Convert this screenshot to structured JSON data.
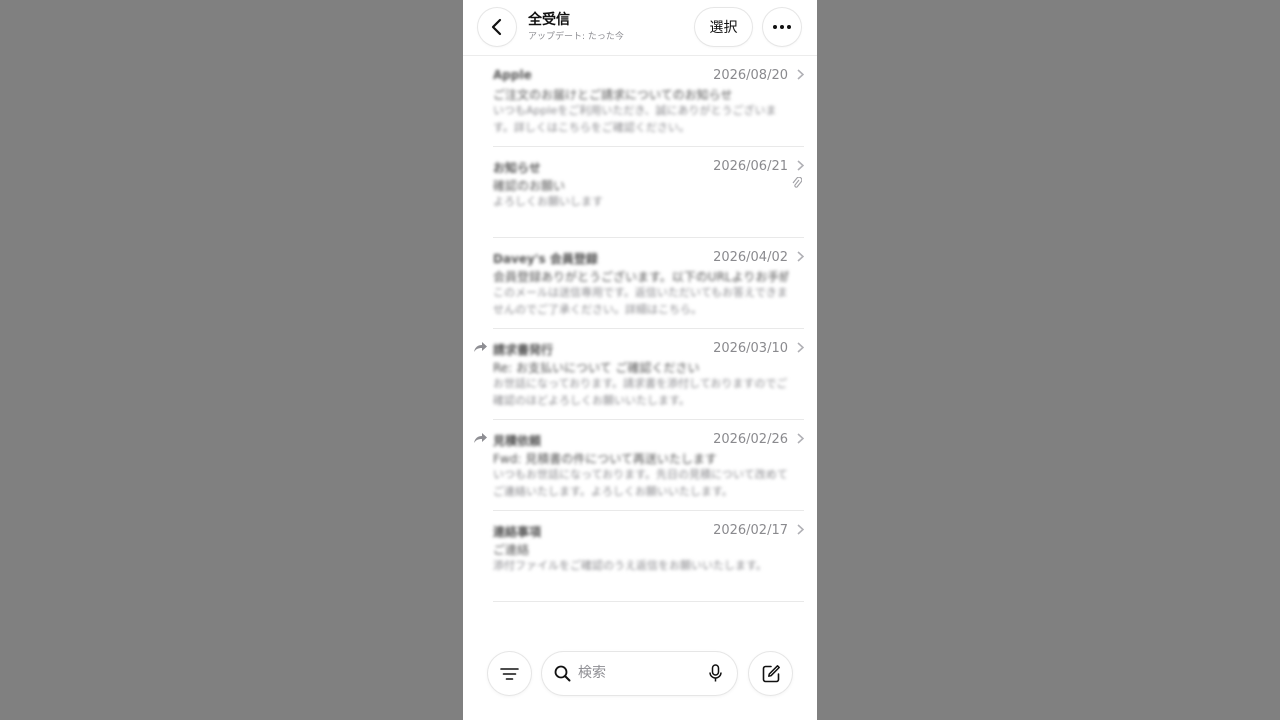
{
  "header": {
    "title": "全受信",
    "subtitle": "アップデート: たった今",
    "select_label": "選択"
  },
  "mails": [
    {
      "sender": "Apple",
      "date": "2026/08/20",
      "subject": "ご注文のお届けとご請求についてのお知らせ",
      "preview": "いつもAppleをご利用いただき、誠にありがとうございます。詳しくはこちらをご確認ください。",
      "forwarded": false,
      "attachment": false
    },
    {
      "sender": "お知らせ",
      "date": "2026/06/21",
      "subject": "確認のお願い",
      "preview": "よろしくお願いします",
      "forwarded": false,
      "attachment": true
    },
    {
      "sender": "Davey's 会員登録",
      "date": "2026/04/02",
      "subject": "会員登録ありがとうございます。以下のURLよりお手続きを完了してください。",
      "preview": "このメールは送信専用です。返信いただいてもお答えできませんのでご了承ください。詳細はこちら。",
      "forwarded": false,
      "attachment": false
    },
    {
      "sender": "請求書発行",
      "date": "2026/03/10",
      "subject": "Re: お支払いについて ご確認ください",
      "preview": "お世話になっております。請求書を添付しておりますのでご確認のほどよろしくお願いいたします。",
      "forwarded": true,
      "attachment": false
    },
    {
      "sender": "見積依頼",
      "date": "2026/02/26",
      "subject": "Fwd: 見積書の件について再送いたします",
      "preview": "いつもお世話になっております。先日の見積について改めてご連絡いたします。よろしくお願いいたします。",
      "forwarded": true,
      "attachment": false
    },
    {
      "sender": "連絡事項",
      "date": "2026/02/17",
      "subject": "ご連絡",
      "preview": "添付ファイルをご確認のうえ返信をお願いいたします。",
      "forwarded": false,
      "attachment": false
    }
  ],
  "toolbar": {
    "search_placeholder": "検索"
  },
  "colors": {
    "backdrop": "#808080",
    "panel": "#ffffff",
    "secondary_text": "#8e8e93"
  }
}
